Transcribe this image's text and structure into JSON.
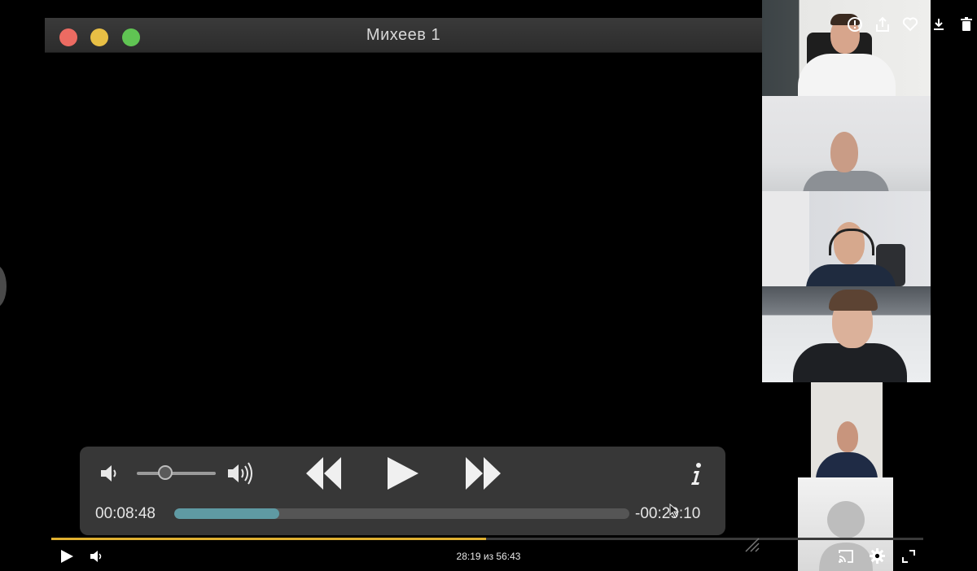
{
  "window": {
    "title": "Михеев 1"
  },
  "hud": {
    "elapsed": "00:08:48",
    "remaining": "-00:29:10",
    "progress_fraction": 0.23,
    "volume_fraction": 0.35,
    "accent": "#5f9aa3"
  },
  "player": {
    "time_readout": "28:19 из 56:43",
    "progress_fraction": 0.499,
    "accent": "#e0b030"
  },
  "top_actions": [
    "info-icon",
    "share-icon",
    "heart-icon",
    "download-icon",
    "trash-icon"
  ],
  "bottom_controls_left": [
    "play-icon",
    "volume-icon"
  ],
  "bottom_controls_right": [
    "cast-icon",
    "settings-icon",
    "fullscreen-icon"
  ],
  "participants": [
    {
      "name": "participant-1"
    },
    {
      "name": "participant-2"
    },
    {
      "name": "participant-3"
    },
    {
      "name": "participant-4"
    },
    {
      "name": "participant-5"
    },
    {
      "name": "participant-6-no-video"
    }
  ]
}
